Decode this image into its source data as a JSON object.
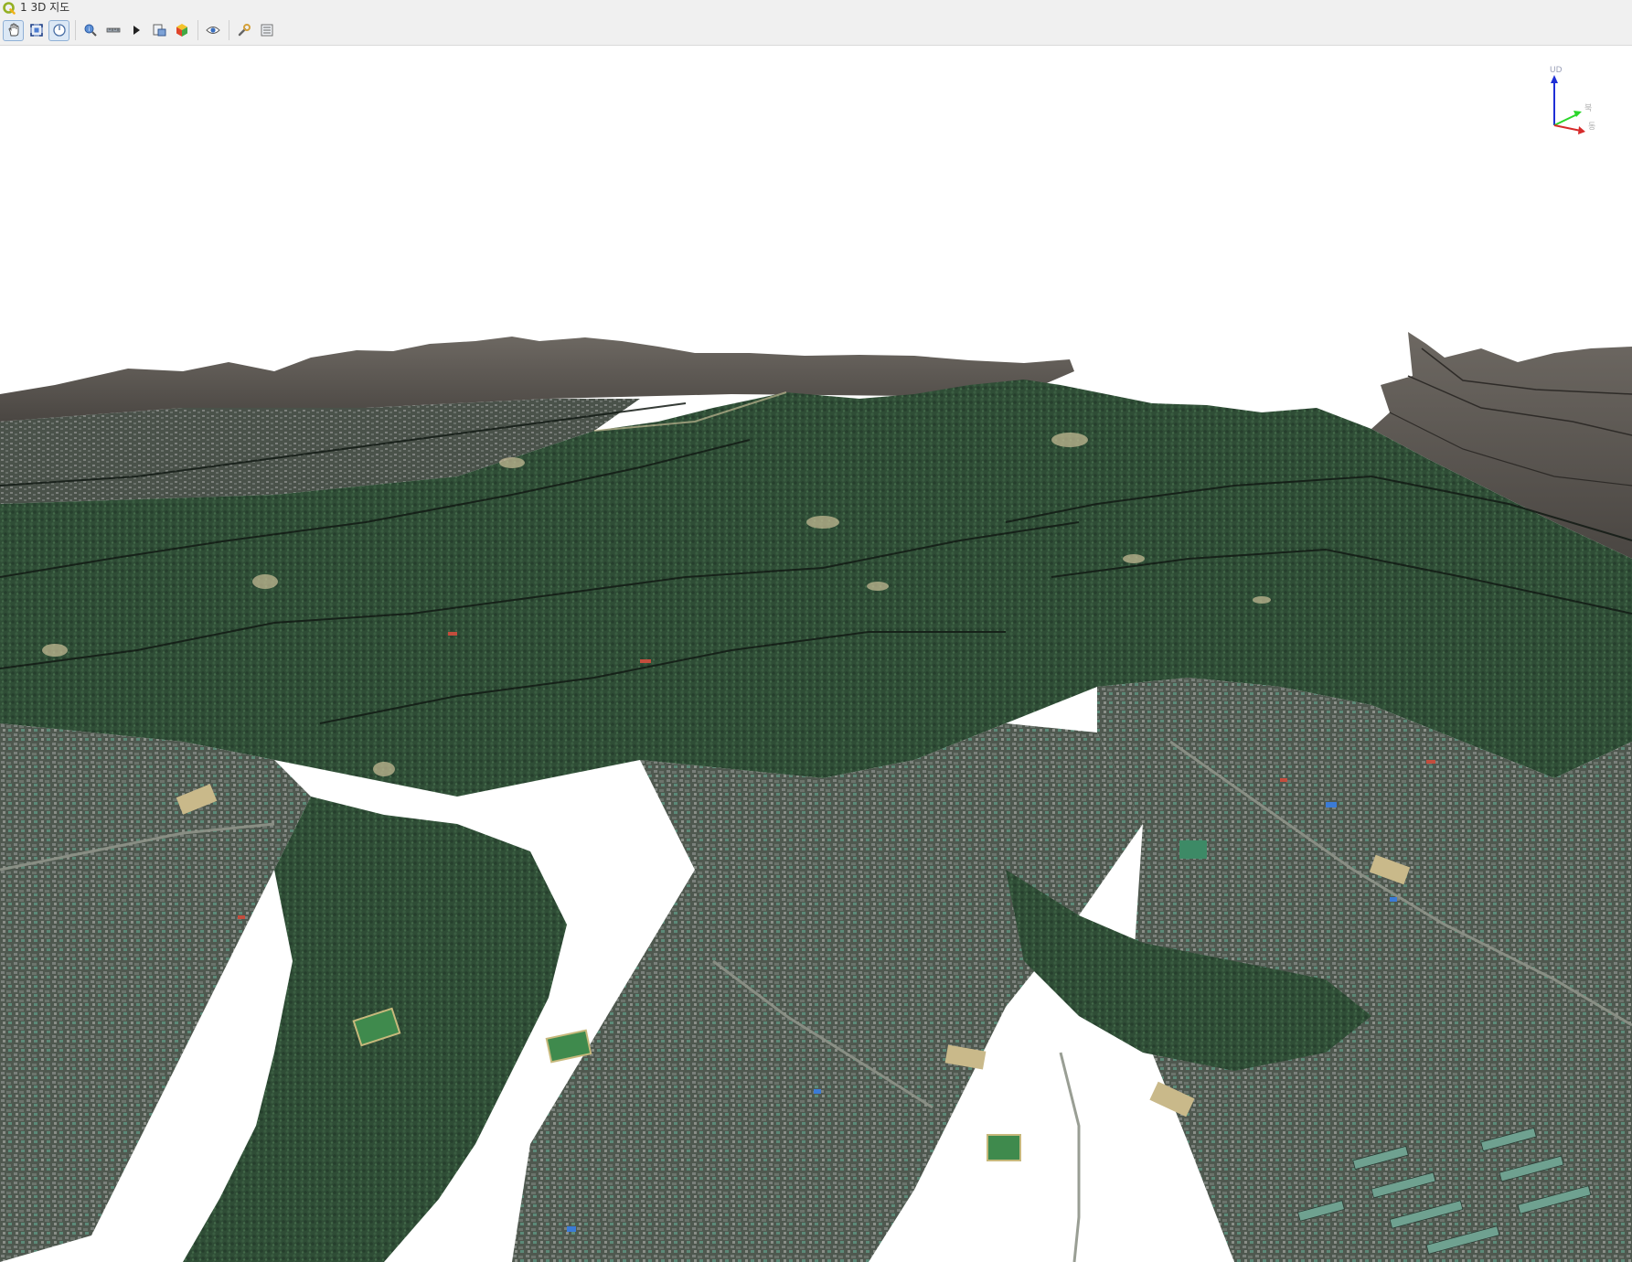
{
  "window": {
    "title": "1 3D 지도"
  },
  "toolbar": {
    "buttons": [
      {
        "icon": "pan-hand-icon",
        "active": true
      },
      {
        "icon": "zoom-full-icon",
        "active": false
      },
      {
        "icon": "camera-rotate-icon",
        "active": true
      },
      {
        "icon": "identify-icon",
        "active": false
      },
      {
        "icon": "measure-line-icon",
        "active": false
      },
      {
        "icon": "animation-play-icon",
        "active": false
      },
      {
        "icon": "save-image-icon",
        "active": false
      },
      {
        "icon": "export-3d-icon",
        "active": false
      },
      {
        "icon": "view-eye-icon",
        "active": false
      },
      {
        "icon": "settings-wrench-icon",
        "active": false
      },
      {
        "icon": "options-menu-icon",
        "active": false
      }
    ]
  },
  "axes": {
    "up_label": "UD",
    "north_label": "북",
    "east_label": "동",
    "colors": {
      "up": "#1f2fd6",
      "north": "#2bd62b",
      "east": "#d62b2b"
    }
  },
  "scene": {
    "sky_color": "#ffffff",
    "forest_color": "#2c4a33",
    "bare_rock_color": "#5a5550",
    "urban_color": "#5a6258"
  }
}
